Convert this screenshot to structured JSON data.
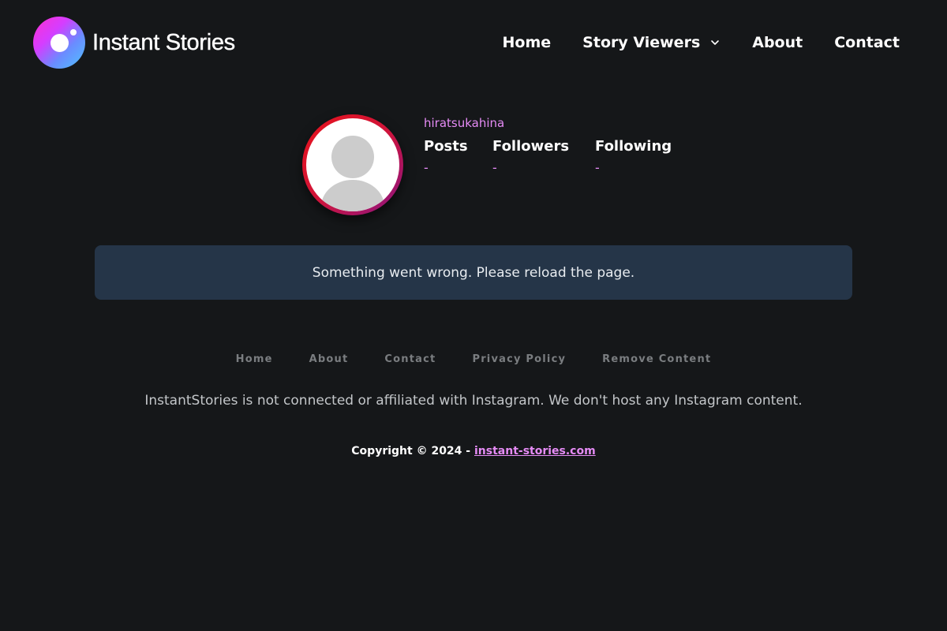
{
  "header": {
    "brand": "Instant Stories",
    "nav": {
      "home": "Home",
      "story_viewers": "Story Viewers",
      "about": "About",
      "contact": "Contact"
    }
  },
  "profile": {
    "username": "hiratsukahina",
    "stats": [
      {
        "label": "Posts",
        "value": "-"
      },
      {
        "label": "Followers",
        "value": "-"
      },
      {
        "label": "Following",
        "value": "-"
      }
    ]
  },
  "alert": {
    "message": "Something went wrong. Please reload the page."
  },
  "footer": {
    "links": [
      "Home",
      "About",
      "Contact",
      "Privacy Policy",
      "Remove Content"
    ],
    "disclaimer": "InstantStories is not connected or affiliated with Instagram. We don't host any Instagram content.",
    "copyright_prefix": "Copyright © 2024 -",
    "copyright_link": "instant-stories.com"
  },
  "colors": {
    "background": "#151719",
    "accent": "#e58bf5",
    "alert_bg": "#253548",
    "avatar_ring_start": "#e8131b",
    "avatar_ring_end": "#8a1584"
  },
  "icons": {
    "logo": "camera-lens-logo-icon",
    "dropdown": "chevron-down-icon",
    "avatar": "default-user-avatar-icon"
  }
}
